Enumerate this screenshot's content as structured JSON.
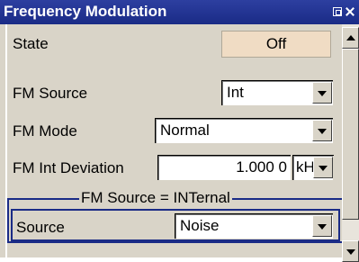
{
  "window": {
    "title": "Frequency Modulation"
  },
  "state": {
    "label": "State",
    "button_label": "Off"
  },
  "fm_source": {
    "label": "FM Source",
    "value": "Int"
  },
  "fm_mode": {
    "label": "FM Mode",
    "value": "Normal"
  },
  "fm_int_deviation": {
    "label": "FM Int Deviation",
    "value": "1.000 0",
    "unit": "kHz"
  },
  "group": {
    "title": "FM Source = INTernal",
    "source": {
      "label": "Source",
      "value": "Noise"
    }
  },
  "icons": [
    "restore-icon",
    "close-icon",
    "chevron-down-icon",
    "scroll-up-icon",
    "scroll-down-icon"
  ]
}
